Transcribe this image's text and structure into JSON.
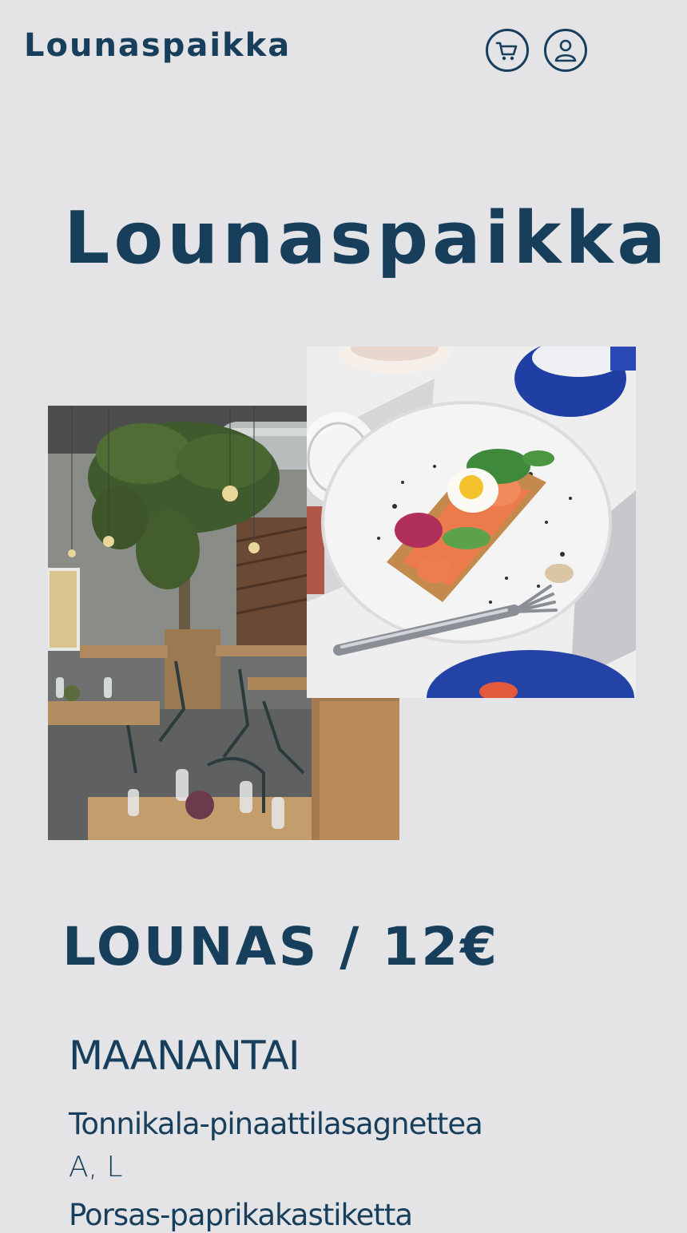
{
  "header": {
    "brand": "Lounaspaikka",
    "cart_icon": "shopping-cart-icon",
    "account_icon": "user-account-icon"
  },
  "hero": {
    "title": "Lounaspaikka"
  },
  "gallery": {
    "images": [
      {
        "name": "restaurant-interior-photo"
      },
      {
        "name": "food-plate-photo"
      }
    ]
  },
  "menu": {
    "heading": "LOUNAS / 12€",
    "day": "MAANANTAI",
    "dishes": [
      {
        "name": "Tonnikala-pinaattilasagnettea",
        "diet": "A, L"
      },
      {
        "name": "Porsas-paprikakastiketta"
      }
    ]
  },
  "colors": {
    "background": "#e4e3e6",
    "brand": "#173f5c"
  }
}
